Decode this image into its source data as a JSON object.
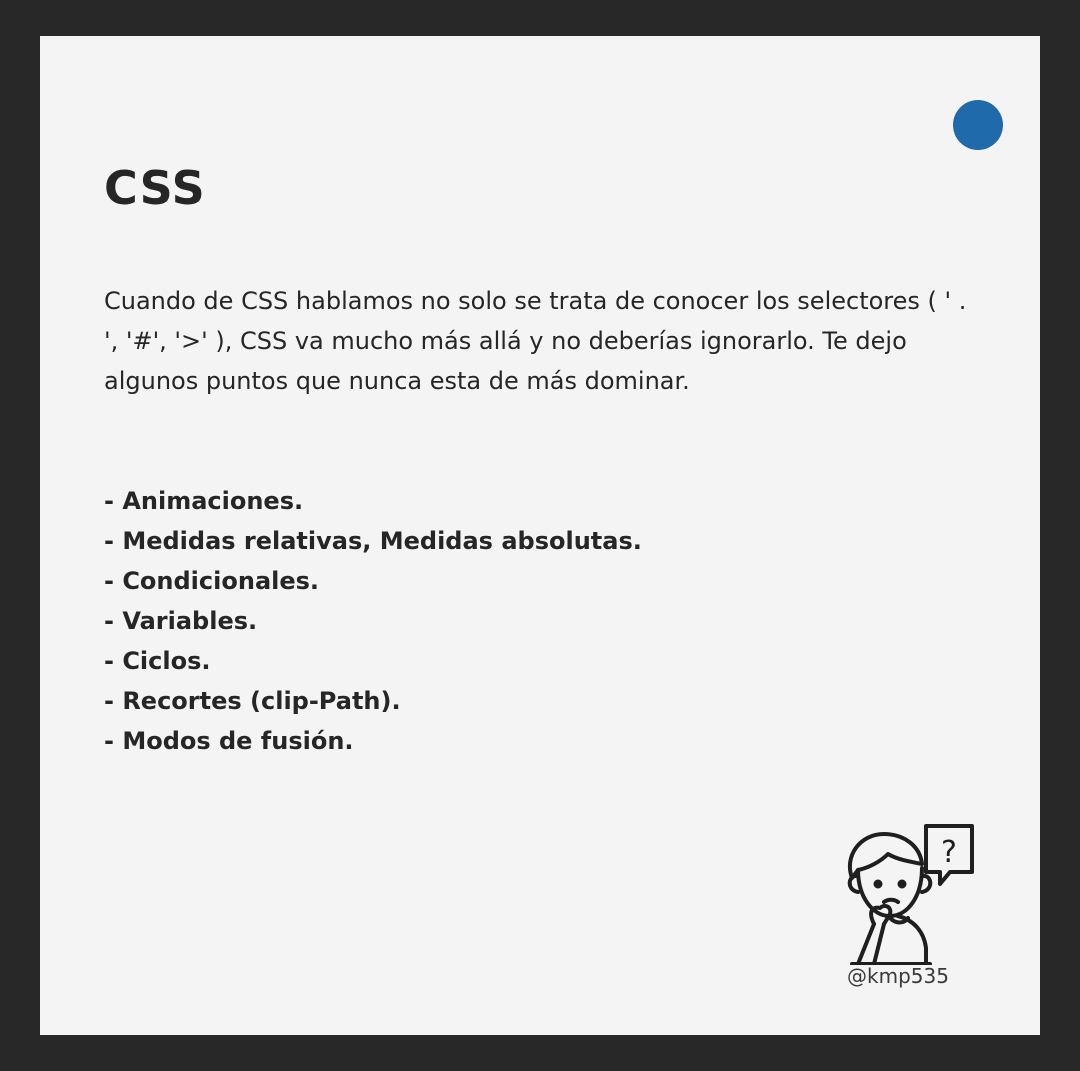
{
  "accent_color": "#1e6aab",
  "title": "CSS",
  "paragraph": "Cuando de CSS hablamos no solo se trata de conocer los selectores ( ' . ', '#', '>' ), CSS va mucho más allá y no deberías ignorarlo. Te dejo algunos puntos que nunca esta de más dominar.",
  "list_items": [
    "- Animaciones.",
    "- Medidas relativas, Medidas absolutas.",
    "- Condicionales.",
    "- Variables.",
    "- Ciclos.",
    "- Recortes (clip-Path).",
    "- Modos de fusión."
  ],
  "illustration": {
    "icon": "thinking-person-icon",
    "bubble_text": "?"
  },
  "handle": "@kmp535"
}
